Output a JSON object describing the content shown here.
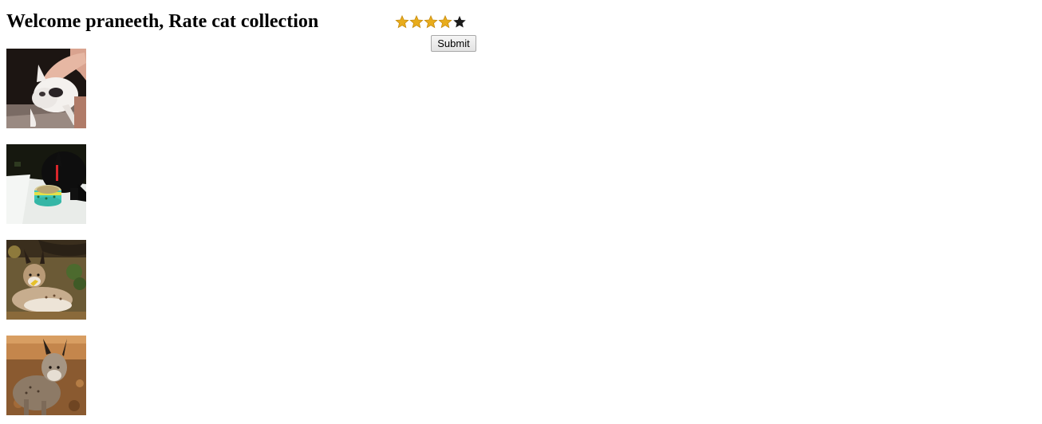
{
  "header": {
    "title": "Welcome praneeth, Rate cat collection"
  },
  "rating": {
    "value": 4,
    "max": 5,
    "filled_color": "#e8ac1c",
    "empty_color": "#1a1a1a",
    "icon": "star-icon"
  },
  "form": {
    "submit_label": "Submit"
  },
  "photos": [
    {
      "subject": "white kitten being petted",
      "icon": "cat-photo"
    },
    {
      "subject": "black cat with a food tin",
      "icon": "cat-photo"
    },
    {
      "subject": "lynx lying in autumn leaves",
      "icon": "cat-photo"
    },
    {
      "subject": "lynx standing in autumn leaves",
      "icon": "cat-photo"
    }
  ]
}
